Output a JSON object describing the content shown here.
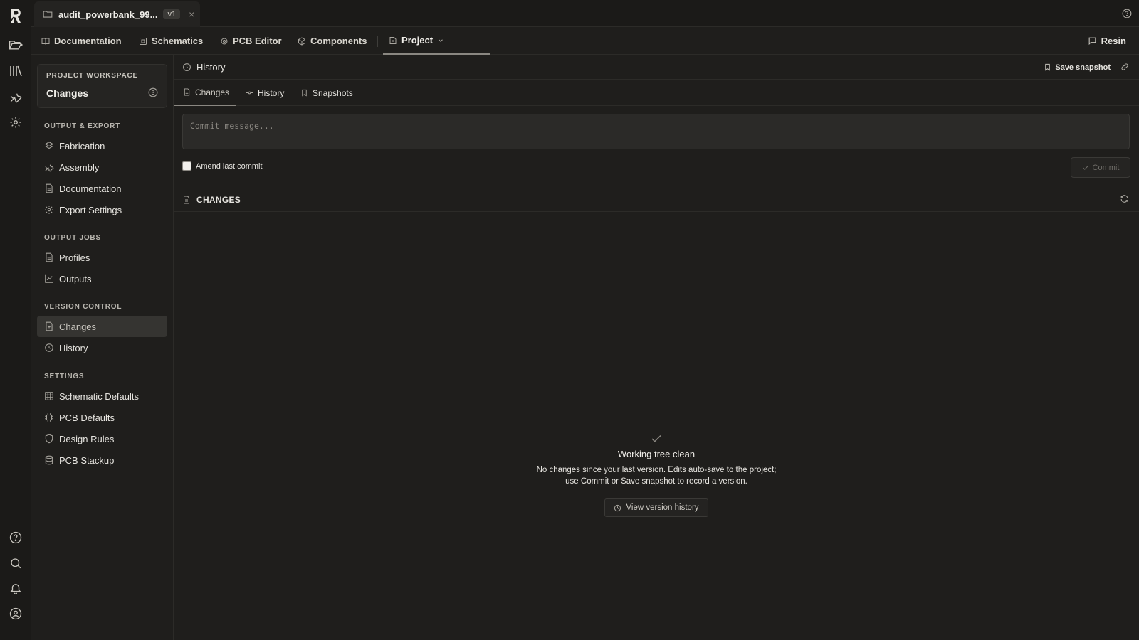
{
  "app": {
    "logo": "R"
  },
  "file_tab": {
    "name": "audit_powerbank_99...",
    "version": "v1",
    "close": "×"
  },
  "nav": {
    "tabs": [
      {
        "label": "Documentation",
        "icon": "book-icon"
      },
      {
        "label": "Schematics",
        "icon": "schematic-icon"
      },
      {
        "label": "PCB Editor",
        "icon": "chip-icon"
      },
      {
        "label": "Components",
        "icon": "cube-icon"
      },
      {
        "label": "Project",
        "icon": "project-icon",
        "active": true
      }
    ],
    "resin_label": "Resin"
  },
  "sidebar": {
    "workspace_label": "PROJECT WORKSPACE",
    "workspace_value": "Changes",
    "sections": [
      {
        "title": "OUTPUT & EXPORT",
        "items": [
          "Fabrication",
          "Assembly",
          "Documentation",
          "Export Settings"
        ]
      },
      {
        "title": "OUTPUT JOBS",
        "items": [
          "Profiles",
          "Outputs"
        ]
      },
      {
        "title": "VERSION CONTROL",
        "items": [
          "Changes",
          "History"
        ]
      },
      {
        "title": "SETTINGS",
        "items": [
          "Schematic Defaults",
          "PCB Defaults",
          "Design Rules",
          "PCB Stackup"
        ]
      }
    ],
    "active_item": "Changes"
  },
  "main": {
    "header_title": "History",
    "save_snapshot_label": "Save snapshot",
    "subtabs": [
      "Changes",
      "History",
      "Snapshots"
    ],
    "commit_placeholder": "Commit message...",
    "amend_label": "Amend last commit",
    "amend_checked": false,
    "commit_label": "Commit",
    "changes_title": "CHANGES",
    "empty": {
      "title": "Working tree clean",
      "description": "No changes since your last version. Edits auto-save to the project; use Commit or Save snapshot to record a version.",
      "button": "View version history"
    }
  },
  "colors": {
    "background": "#1f1e1c",
    "rail": "#1b1a18",
    "active_item": "#353431",
    "border": "#2c2b28"
  }
}
